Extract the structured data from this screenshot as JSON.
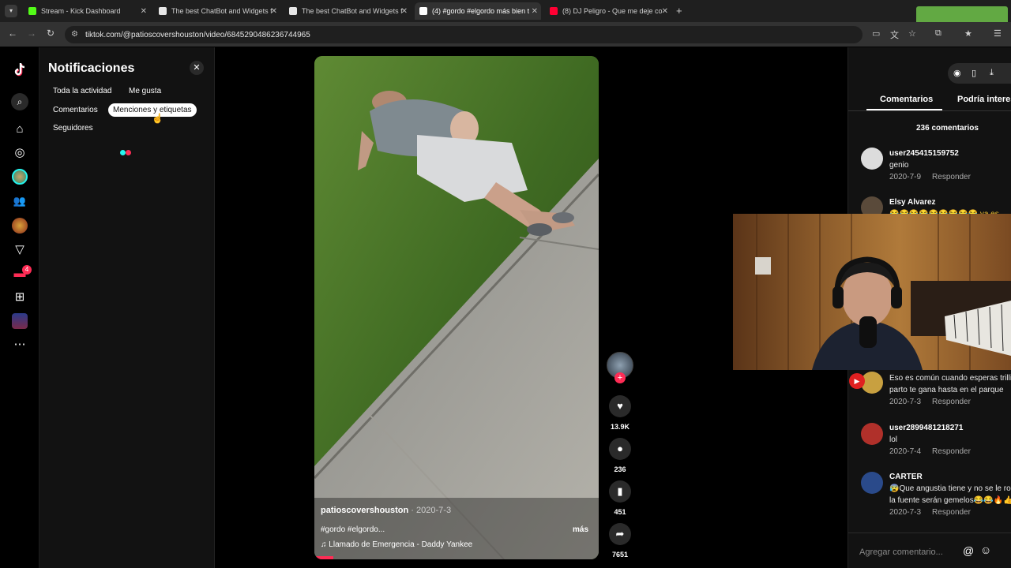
{
  "browser": {
    "tabs": [
      {
        "title": "Stream - Kick Dashboard",
        "favicon_color": "#53fc18",
        "active": false
      },
      {
        "title": "The best ChatBot and Widgets f",
        "favicon_color": "#e6e6e6",
        "active": false
      },
      {
        "title": "The best ChatBot and Widgets f",
        "favicon_color": "#e6e6e6",
        "active": false
      },
      {
        "title": "(4) #gordo #elgordo más bien t",
        "favicon_color": "#ffffff",
        "active": true
      },
      {
        "title": "(8) DJ Peligro - Que me deje co",
        "favicon_color": "#ff0033",
        "active": false
      }
    ],
    "url": "tiktok.com/@patioscovershouston/video/6845290486236744965"
  },
  "sidebar": {
    "icons": [
      "tiktok-logo-icon",
      "search-icon",
      "home-icon",
      "explore-icon",
      "profile-avatar",
      "following-icon",
      "live-avatar",
      "send-icon",
      "inbox-icon",
      "upload-icon",
      "avatar-small",
      "more-icon"
    ],
    "inbox_badge": "4"
  },
  "notifications": {
    "title": "Notificaciones",
    "filters": [
      "Toda la actividad",
      "Me gusta",
      "Comentarios",
      "Menciones y etiquetas",
      "Seguidores"
    ],
    "selected": "Menciones y etiquetas"
  },
  "video": {
    "author": "patioscovershouston",
    "date": "2020-7-3",
    "caption": "#gordo #elgordo...",
    "more": "más",
    "music": "Llamado de Emergencia - Daddy Yankee"
  },
  "actions": {
    "likes": "13.9K",
    "comments": "236",
    "saves": "451",
    "shares": "7651"
  },
  "panel": {
    "tabs": [
      "Comentarios",
      "Podría interesar"
    ],
    "count_label": "236 comentarios",
    "reply_label": "Responder",
    "comments": [
      {
        "user": "user245415159752",
        "text": "genio",
        "date": "2020-7-9",
        "avatar_color": "#dddddd"
      },
      {
        "user": "Elsy Alvarez",
        "text": "😂😂😂😂😂😂😂😂😂 ya es",
        "date": "",
        "avatar_color": "#5a4a3a"
      },
      {
        "user": "",
        "text": "Eso es común cuando esperas trilli",
        "text2": "parto te gana hasta en el parque",
        "date": "2020-7-3",
        "avatar_color": "#c8a040"
      },
      {
        "user": "user2899481218271",
        "text": "lol",
        "date": "2020-7-4",
        "avatar_color": "#b0302a"
      },
      {
        "user": "CARTER",
        "text": "😰Que angustia tiene y no se le ro",
        "text2": "la fuente serán gemelos😂😂🔥👍",
        "date": "2020-7-3",
        "avatar_color": "#2a4a8a"
      }
    ],
    "input_placeholder": "Agregar comentario...",
    "input_icons": [
      "mention-icon",
      "emoji-icon"
    ]
  },
  "colors": {
    "tiktok_red": "#fe2c55",
    "tiktok_cyan": "#25f4ee"
  }
}
